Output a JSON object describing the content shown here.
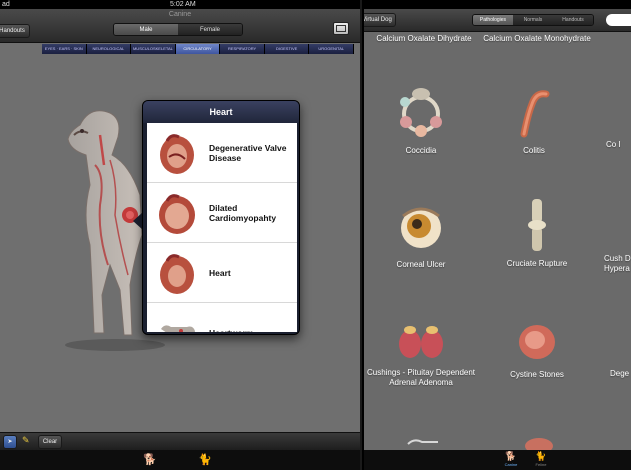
{
  "left": {
    "status": {
      "carrier": "ad",
      "time": "5:02 AM"
    },
    "app_title": "Canine",
    "handouts_label": "Handouts",
    "gender": {
      "options": [
        "Male",
        "Female"
      ],
      "selected": 0
    },
    "systems": {
      "tabs": [
        "EYES · EARS · SKIN",
        "NEUROLOGICAL",
        "MUSCULOSKELETAL",
        "CIRCULATORY",
        "RESPIRATORY",
        "DIGESTIVE",
        "UROGENITAL"
      ],
      "selected": 3
    },
    "popover": {
      "title": "Heart",
      "items": [
        "Degenerative Valve Disease",
        "Dilated Cardiomyopahty",
        "Heart",
        "Heartworm"
      ]
    },
    "toolbar": {
      "clear_label": "Clear"
    }
  },
  "right": {
    "virtual_dog_label": "Virtual Dog",
    "filter": {
      "options": [
        "Pathologies",
        "Normals",
        "Handouts"
      ],
      "selected": 0
    },
    "items": {
      "calcium_oxalate_dihydrate": "Calcium Oxalate Dihydrate",
      "calcium_oxalate_monohydrate": "Calcium Oxalate Monohydrate",
      "coccidia": "Coccidia",
      "colitis": "Colitis",
      "co_partial": "Co I",
      "corneal_ulcer": "Corneal Ulcer",
      "cruciate_rupture": "Cruciate Rupture",
      "cush_partial": "Cush D Hypera",
      "cushings": "Cushings - Pituitay Dependent Adrenal Adenoma",
      "cystine_stones": "Cystine Stones",
      "dege_partial": "Dege"
    },
    "tabs": [
      "Canine",
      "Feline"
    ],
    "selected_tab": 0
  },
  "colors": {
    "accent_selected_tab": "#4f6fc0",
    "tab_active": "#6fb6ff"
  }
}
